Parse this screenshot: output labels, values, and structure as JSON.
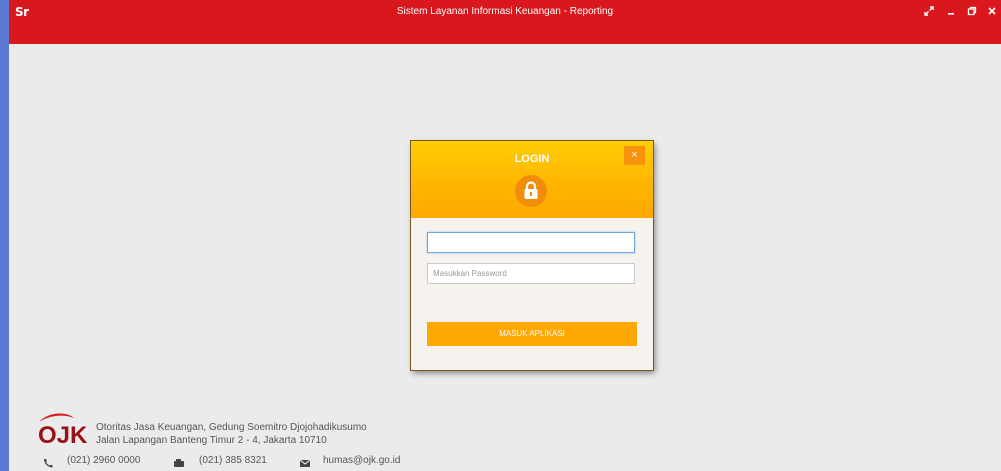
{
  "window": {
    "app_logo": "Sr",
    "title": "Sistem Layanan Informasi Keuangan - Reporting"
  },
  "login": {
    "title": "LOGIN",
    "close_label": "×",
    "username_value": "",
    "password_placeholder": "Masukkan Password",
    "submit_label": "MASUK APLIKASI"
  },
  "footer": {
    "logo_text": "OJK",
    "line1": "Otoritas Jasa Keuangan, Gedung Soemitro Djojohadikusumo",
    "line2": "Jalan Lapangan Banteng Timur 2 - 4, Jakarta 10710",
    "phone": "(021) 2960 0000",
    "fax": "(021) 385 8321",
    "email": "humas@ojk.go.id"
  },
  "colors": {
    "titlebar": "#d9181e",
    "accent": "#ffa702",
    "left_edge": "#5b79d1"
  },
  "icons": [
    "fullscreen-icon",
    "minimize-icon",
    "restore-icon",
    "close-icon",
    "lock-icon",
    "phone-icon",
    "fax-icon",
    "mail-icon"
  ]
}
